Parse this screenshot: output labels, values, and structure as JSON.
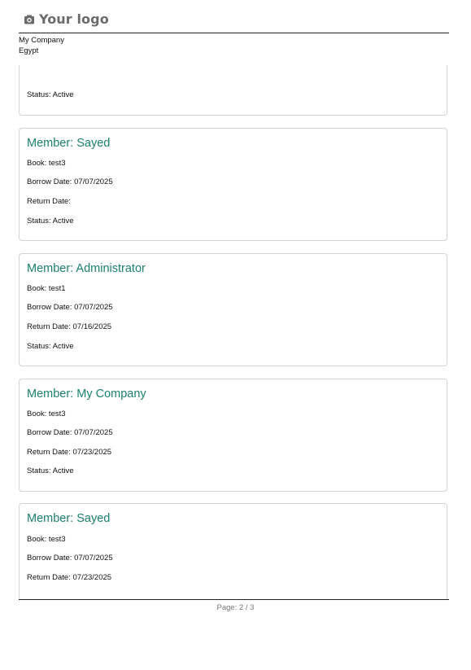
{
  "header": {
    "logo_icon": "camera-icon",
    "logo_text": "Your logo",
    "company_name": "My Company",
    "company_country": "Egypt"
  },
  "records": [
    {
      "status": "Status: Active"
    },
    {
      "title": "Member: Sayed",
      "book": "Book: test3",
      "borrow_date": "Borrow Date: 07/07/2025",
      "return_date": "Return Date:",
      "status": "Status: Active"
    },
    {
      "title": "Member: Administrator",
      "book": "Book: test1",
      "borrow_date": "Borrow Date: 07/07/2025",
      "return_date": "Return Date: 07/16/2025",
      "status": "Status: Active"
    },
    {
      "title": "Member: My Company",
      "book": "Book: test3",
      "borrow_date": "Borrow Date: 07/07/2025",
      "return_date": "Return Date: 07/23/2025",
      "status": "Status: Active"
    },
    {
      "title": "Member: Sayed",
      "book": "Book: test3",
      "borrow_date": "Borrow Date: 07/07/2025",
      "return_date": "Return Date: 07/23/2025"
    }
  ],
  "footer": {
    "page": "Page: 2 / 3"
  },
  "colors": {
    "title": "#1c7f6e",
    "card_border": "#d3d3d3",
    "logo": "#6b6b6b"
  }
}
